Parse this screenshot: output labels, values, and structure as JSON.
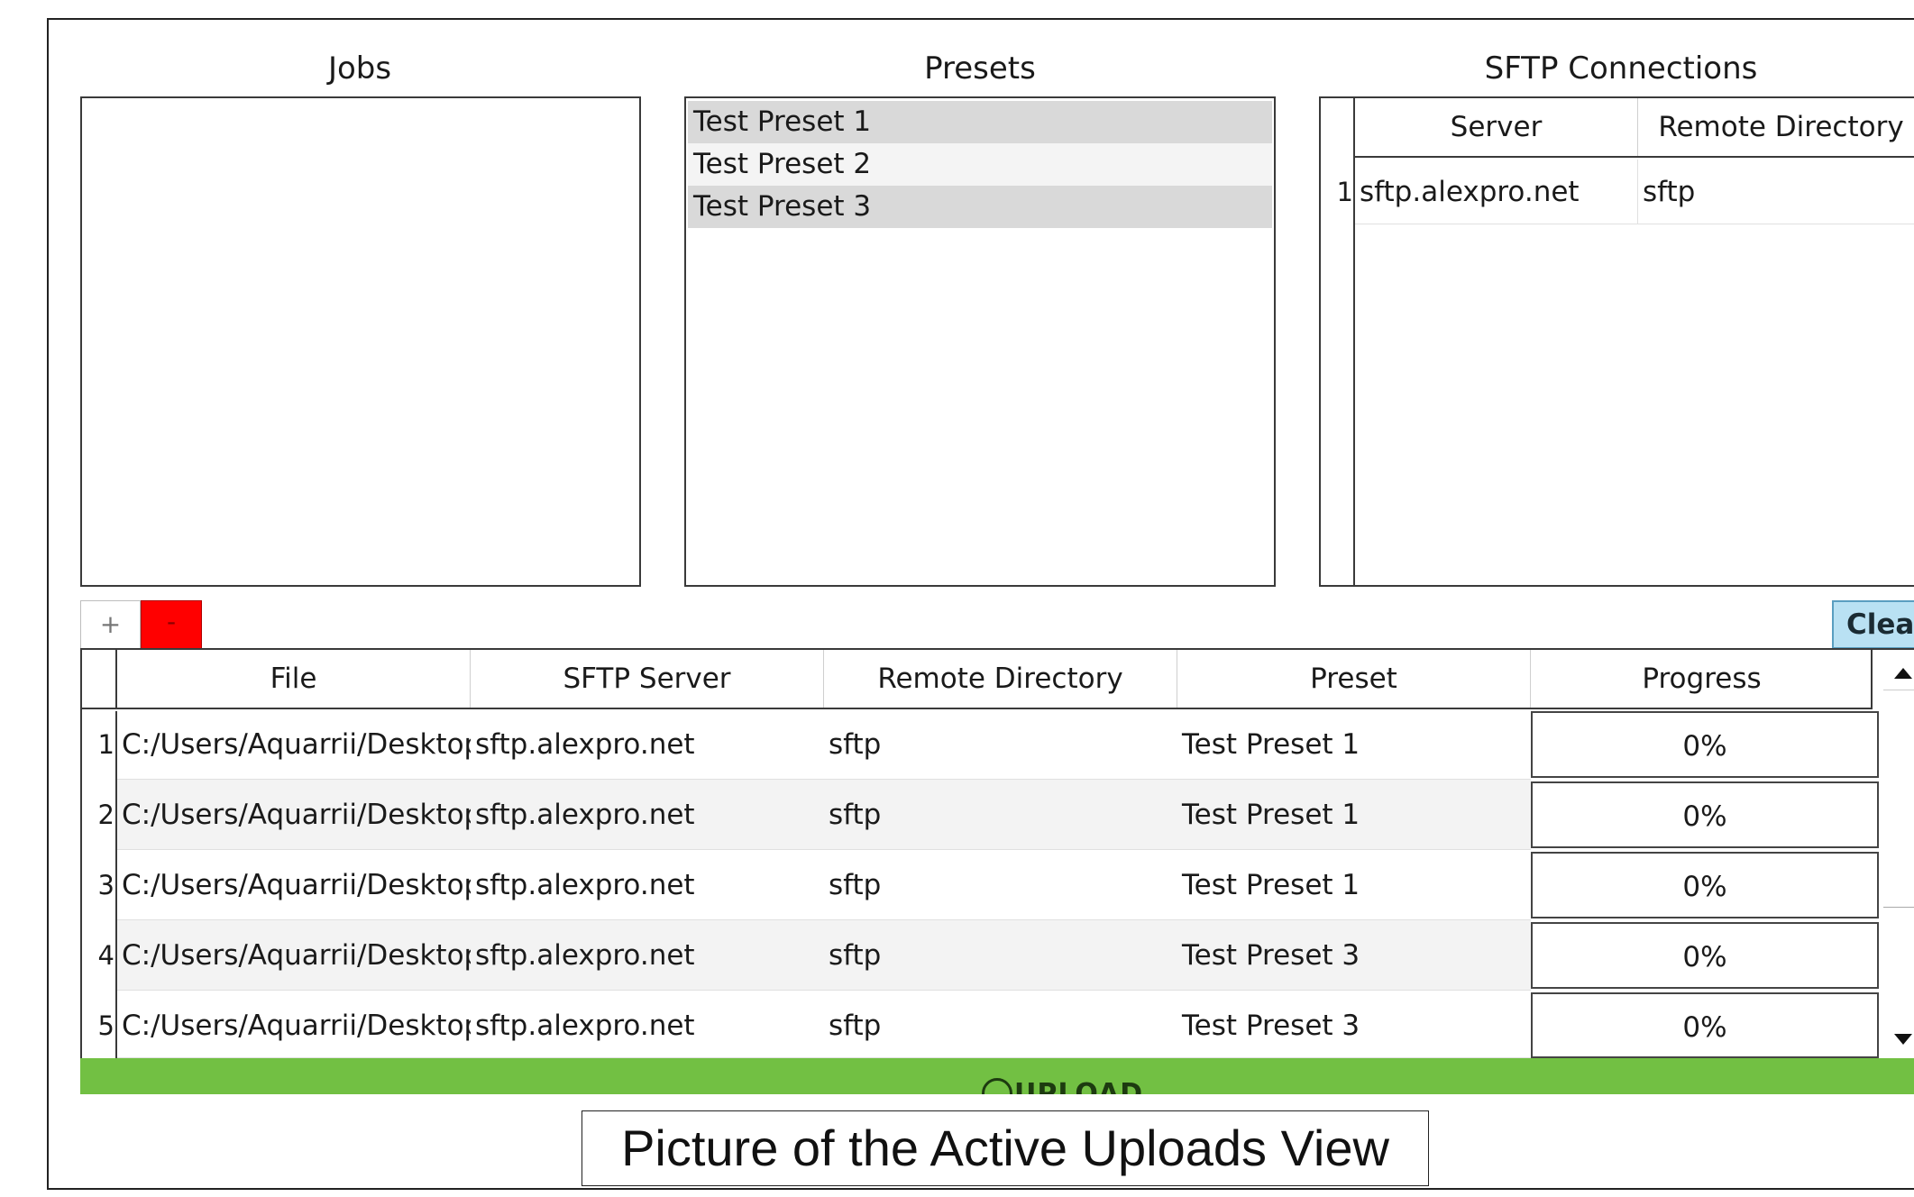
{
  "panels": {
    "jobs": {
      "title": "Jobs"
    },
    "presets": {
      "title": "Presets",
      "items": [
        "Test Preset 1",
        "Test Preset 2",
        "Test Preset 3"
      ]
    },
    "sftp": {
      "title": "SFTP Connections",
      "columns": [
        "Server",
        "Remote Directory"
      ],
      "rows": [
        {
          "num": "1",
          "server": "sftp.alexpro.net",
          "remote_directory": "sftp"
        }
      ]
    }
  },
  "toolbar": {
    "add_label": "+",
    "remove_label": "-",
    "clear_label": "Clear"
  },
  "uploads": {
    "columns": [
      "File",
      "SFTP Server",
      "Remote Directory",
      "Preset",
      "Progress"
    ],
    "rows": [
      {
        "num": "1",
        "file": "C:/Users/Aquarrii/Desktop...",
        "server": "sftp.alexpro.net",
        "remote_directory": "sftp",
        "preset": "Test Preset 1",
        "progress": "0%"
      },
      {
        "num": "2",
        "file": "C:/Users/Aquarrii/Desktop...",
        "server": "sftp.alexpro.net",
        "remote_directory": "sftp",
        "preset": "Test Preset 1",
        "progress": "0%"
      },
      {
        "num": "3",
        "file": "C:/Users/Aquarrii/Desktop...",
        "server": "sftp.alexpro.net",
        "remote_directory": "sftp",
        "preset": "Test Preset 1",
        "progress": "0%"
      },
      {
        "num": "4",
        "file": "C:/Users/Aquarrii/Desktop...",
        "server": "sftp.alexpro.net",
        "remote_directory": "sftp",
        "preset": "Test Preset 3",
        "progress": "0%"
      },
      {
        "num": "5",
        "file": "C:/Users/Aquarrii/Desktop...",
        "server": "sftp.alexpro.net",
        "remote_directory": "sftp",
        "preset": "Test Preset 3",
        "progress": "0%"
      }
    ]
  },
  "upload_button": {
    "label": "UPLOAD",
    "color": "#72c043"
  },
  "caption": "Picture of the Active Uploads View",
  "colors": {
    "remove_button": "#ff0000",
    "clear_button": "#b9e1f3",
    "selected_row": "#d9d9d9"
  },
  "icons": {
    "upload": "upload-icon",
    "scroll_up": "up-arrow-icon",
    "scroll_down": "down-arrow-icon"
  }
}
